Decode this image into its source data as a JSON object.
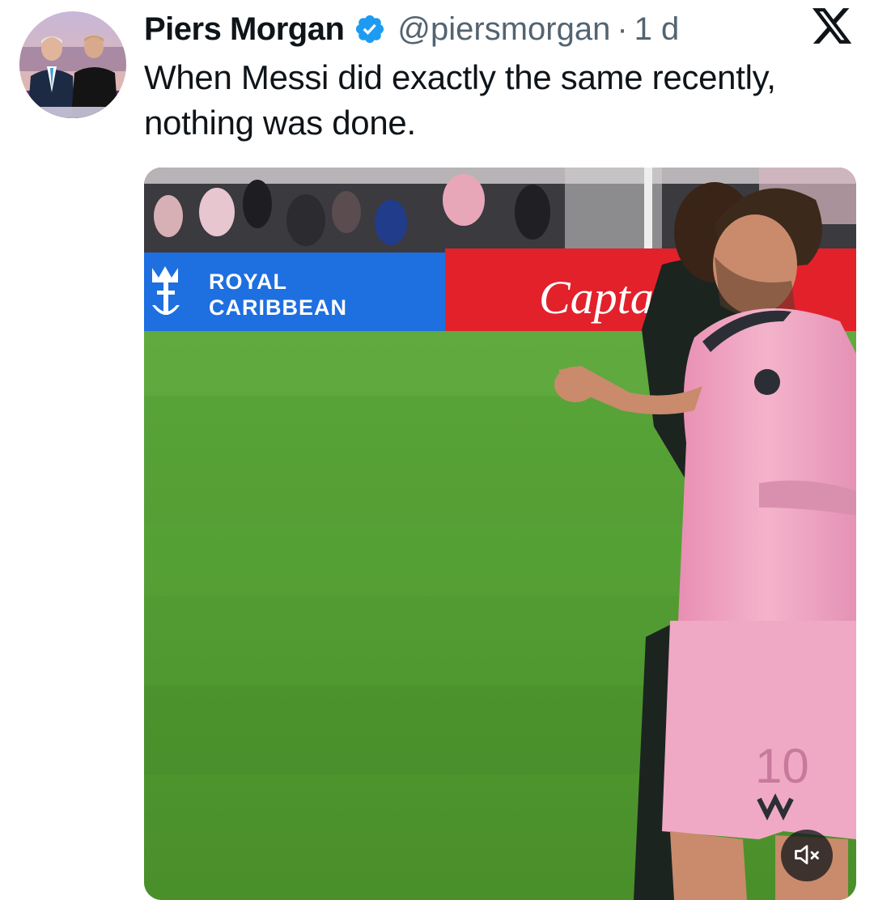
{
  "tweet": {
    "author": {
      "display_name": "Piers Morgan",
      "handle": "@piersmorgan",
      "verified": true,
      "avatar_icon": "profile-photo"
    },
    "separator": "·",
    "timestamp": "1 d",
    "text": "When Messi did exactly the same recently, nothing was done.",
    "platform_icon": "x-logo-icon"
  },
  "media": {
    "type": "video",
    "sound_muted": true,
    "mute_icon": "speaker-muted-icon",
    "ad_board": {
      "left_brand_line1": "ROYAL",
      "left_brand_line2": "CARIBBEAN",
      "right_brand": "Captain M"
    },
    "jersey_number": "10"
  },
  "colors": {
    "verified_blue": "#1d9bf0",
    "secondary_text": "#536471",
    "primary_text": "#0f1419",
    "pitch_green": "#4f9a2c",
    "jersey_pink": "#f2a7c3",
    "ad_blue": "#1e6fe0",
    "ad_red": "#e3212b"
  }
}
